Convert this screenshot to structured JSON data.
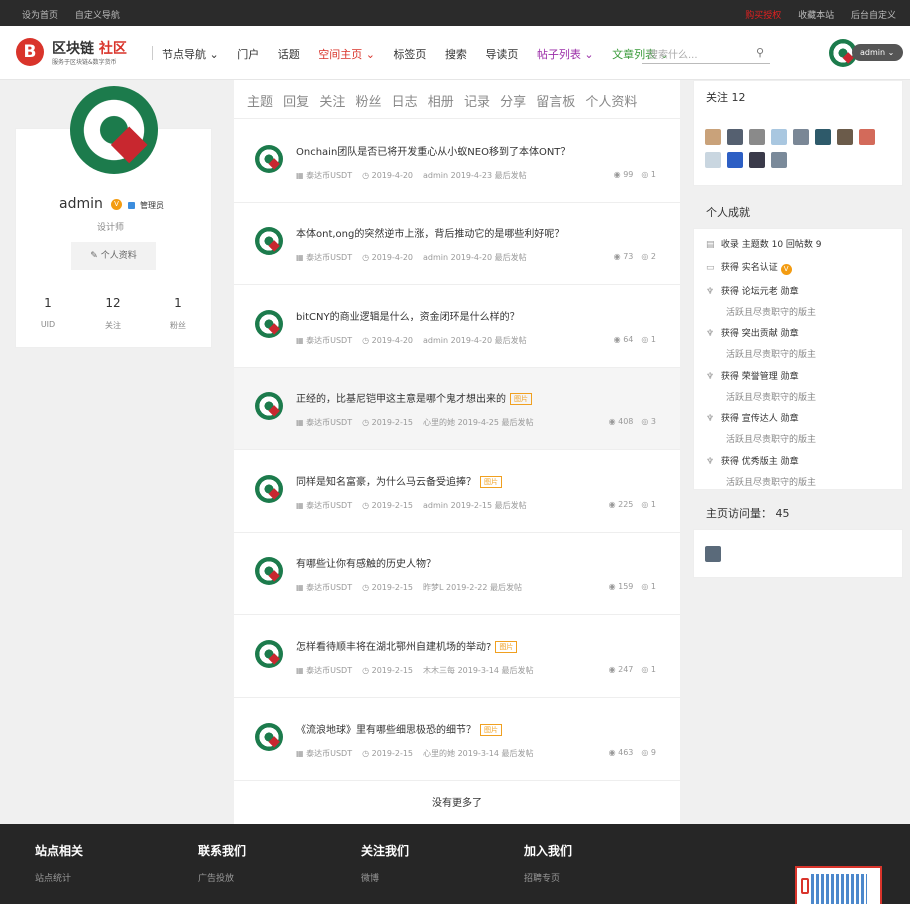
{
  "topbar": {
    "left": [
      "设为首页",
      "自定义导航"
    ],
    "right": [
      "购买授权",
      "收藏本站",
      "后台自定义"
    ]
  },
  "logo": {
    "mark": "B",
    "name": "区块链",
    "name2": "社区",
    "slogan": "服务于区块链&数字货币"
  },
  "nav": [
    {
      "label": "节点导航 ⌄"
    },
    {
      "label": "门户"
    },
    {
      "label": "话题"
    },
    {
      "label": "空间主页 ⌄"
    },
    {
      "label": "标签页"
    },
    {
      "label": "搜索"
    },
    {
      "label": "导读页"
    },
    {
      "label": "帖子列表 ⌄"
    },
    {
      "label": "文章列表 ⌄"
    }
  ],
  "search": {
    "placeholder": "搜索什么...",
    "icon": "search-icon"
  },
  "user": {
    "name": "admin",
    "menu_label": "admin ⌄",
    "badge": "V",
    "role": "管理员",
    "title": "设计师",
    "profile_btn": "✎ 个人资料"
  },
  "stats": [
    {
      "n": "1",
      "l": "UID"
    },
    {
      "n": "12",
      "l": "关注"
    },
    {
      "n": "1",
      "l": "粉丝"
    }
  ],
  "tabs": [
    "主题",
    "回复",
    "关注",
    "粉丝",
    "日志",
    "相册",
    "记录",
    "分享",
    "留言板",
    "个人资料"
  ],
  "posts": [
    {
      "title": "Onchain团队是否已将开发重心从小蚁NEO移到了本体ONT？",
      "tag": "",
      "forum": "▦ 泰达币USDT",
      "date": "◷ 2019-4-20",
      "last": "admin 2019-4-23 最后发帖",
      "views": "◉ 99",
      "replies": "◎ 1"
    },
    {
      "title": "本体ont,ong的突然逆市上涨，背后推动它的是哪些利好呢？",
      "tag": "",
      "forum": "▦ 泰达币USDT",
      "date": "◷ 2019-4-20",
      "last": "admin 2019-4-20 最后发帖",
      "views": "◉ 73",
      "replies": "◎ 2"
    },
    {
      "title": "bitCNY的商业逻辑是什么，资金闭环是什么样的？",
      "tag": "",
      "forum": "▦ 泰达币USDT",
      "date": "◷ 2019-4-20",
      "last": "admin 2019-4-20 最后发帖",
      "views": "◉ 64",
      "replies": "◎ 1"
    },
    {
      "title": "正经的，比基尼铠甲这主意是哪个鬼才想出来的",
      "tag": "图片",
      "forum": "▦ 泰达币USDT",
      "date": "◷ 2019-2-15",
      "last": "心里的她 2019-4-25 最后发帖",
      "views": "◉ 408",
      "replies": "◎ 3"
    },
    {
      "title": "同样是知名富豪，为什么马云备受追捧？",
      "tag": "图片",
      "forum": "▦ 泰达币USDT",
      "date": "◷ 2019-2-15",
      "last": "admin 2019-2-15 最后发帖",
      "views": "◉ 225",
      "replies": "◎ 1"
    },
    {
      "title": "有哪些让你有感触的历史人物？",
      "tag": "",
      "forum": "▦ 泰达币USDT",
      "date": "◷ 2019-2-15",
      "last": "昨梦L 2019-2-22 最后发帖",
      "views": "◉ 159",
      "replies": "◎ 1"
    },
    {
      "title": "怎样看待顺丰将在湖北鄂州自建机场的举动?",
      "tag": "图片",
      "forum": "▦ 泰达币USDT",
      "date": "◷ 2019-2-15",
      "last": "木木三每 2019-3-14 最后发帖",
      "views": "◉ 247",
      "replies": "◎ 1"
    },
    {
      "title": "《流浪地球》里有哪些细思极恐的细节？",
      "tag": "图片",
      "forum": "▦ 泰达币USDT",
      "date": "◷ 2019-2-15",
      "last": "心里的她 2019-3-14 最后发帖",
      "views": "◉ 463",
      "replies": "◎ 9"
    }
  ],
  "nomore": "没有更多了",
  "follow": {
    "title": "关注 12"
  },
  "achieve": {
    "title": "个人成就",
    "items": [
      {
        "icon": "▤",
        "text": "收录 主题数 10 回帖数 9",
        "sub": ""
      },
      {
        "icon": "▭",
        "text": "获得 实名认证",
        "sub": "",
        "badge": "V"
      },
      {
        "icon": "♆",
        "text": "获得 论坛元老 勋章",
        "sub": "活跃且尽责职守的版主"
      },
      {
        "icon": "♆",
        "text": "获得 突出贡献 勋章",
        "sub": "活跃且尽责职守的版主"
      },
      {
        "icon": "♆",
        "text": "获得 荣誉管理 勋章",
        "sub": "活跃且尽责职守的版主"
      },
      {
        "icon": "♆",
        "text": "获得 宣传达人 勋章",
        "sub": "活跃且尽责职守的版主"
      },
      {
        "icon": "♆",
        "text": "获得 优秀版主 勋章",
        "sub": "活跃且尽责职守的版主"
      }
    ]
  },
  "visits": {
    "title": "主页访问量： 45"
  },
  "footer": [
    {
      "h": "站点相关",
      "i": "站点统计"
    },
    {
      "h": "联系我们",
      "i": "广告投放"
    },
    {
      "h": "关注我们",
      "i": "微博"
    },
    {
      "h": "加入我们",
      "i": "招聘专页"
    }
  ],
  "colors": {
    "brand": "#d9342b",
    "green": "#1c7b4c",
    "topbar": "#2b2b2b",
    "footer": "#262626"
  }
}
